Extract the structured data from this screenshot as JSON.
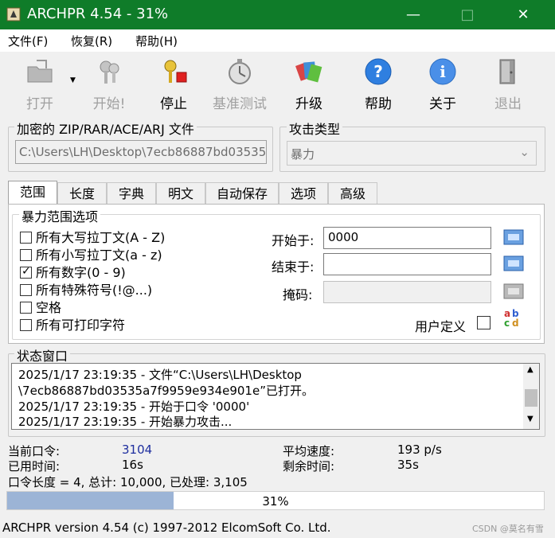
{
  "window": {
    "title": "ARCHPR 4.54 - 31%",
    "minimize": "—",
    "maximize": "□",
    "close": "✕"
  },
  "menu": [
    "文件(F)",
    "恢复(R)",
    "帮助(H)"
  ],
  "toolbar": {
    "open": "打开",
    "start": "开始!",
    "stop": "停止",
    "benchmark": "基准测试",
    "upgrade": "升级",
    "help": "帮助",
    "about": "关于",
    "exit": "退出"
  },
  "file_group": {
    "title": "加密的 ZIP/RAR/ACE/ARJ 文件",
    "path": "C:\\Users\\LH\\Desktop\\7ecb86887bd03535a"
  },
  "attack_group": {
    "title": "攻击类型",
    "value": "暴力"
  },
  "tabs": [
    "范围",
    "长度",
    "字典",
    "明文",
    "自动保存",
    "选项",
    "高级"
  ],
  "range": {
    "title": "暴力范围选项",
    "options": [
      {
        "label": "所有大写拉丁文(A - Z)",
        "checked": false
      },
      {
        "label": "所有小写拉丁文(a - z)",
        "checked": false
      },
      {
        "label": "所有数字(0 - 9)",
        "checked": true
      },
      {
        "label": "所有特殊符号(!@...)",
        "checked": false
      },
      {
        "label": "空格",
        "checked": false
      },
      {
        "label": "所有可打印字符",
        "checked": false
      }
    ],
    "start_label": "开始于:",
    "start_value": "0000",
    "end_label": "结束于:",
    "end_value": "",
    "mask_label": "掩码:",
    "mask_value": "",
    "user_defined": "用户定义",
    "abc_icon": "abcd"
  },
  "status": {
    "title": "状态窗口",
    "lines": [
      "2025/1/17 23:19:35 - 文件“C:\\Users\\LH\\Desktop",
      "\\7ecb86887bd03535a7f9959e934e901e”已打开。",
      "2025/1/17 23:19:35 - 开始于口令 '0000'",
      "2025/1/17 23:19:35 - 开始暴力攻击..."
    ],
    "scroll_up": "▲",
    "scroll_down": "▼"
  },
  "stats": {
    "current_label": "当前口令:",
    "current_value": "3104",
    "elapsed_label": "已用时间:",
    "elapsed_value": "16s",
    "speed_label": "平均速度:",
    "speed_value": "193 p/s",
    "remaining_label": "剩余时间:",
    "remaining_value": "35s",
    "summary": "口令长度 = 4, 总计: 10,000, 已处理: 3,105"
  },
  "progress": {
    "percent_label": "31%",
    "fraction": 0.31
  },
  "statusbar": {
    "text": "ARCHPR version 4.54 (c) 1997-2012 ElcomSoft Co. Ltd.",
    "watermark": "CSDN @莫名有雪"
  },
  "colors": {
    "titlebar": "#0f7c29",
    "progress_fill": "#9cb4d6",
    "current_value": "#1f2f9f"
  }
}
